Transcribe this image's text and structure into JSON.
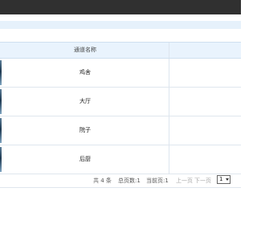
{
  "table": {
    "header": "通道名称",
    "rows": [
      {
        "name": "鸡舍"
      },
      {
        "name": "大厅"
      },
      {
        "name": "院子"
      },
      {
        "name": "后厨"
      }
    ]
  },
  "pager": {
    "total": "共 4 条",
    "pages": "总页数:1",
    "current": "当前页:1",
    "prev": "上一页",
    "next": "下一页",
    "page_select": "1"
  }
}
